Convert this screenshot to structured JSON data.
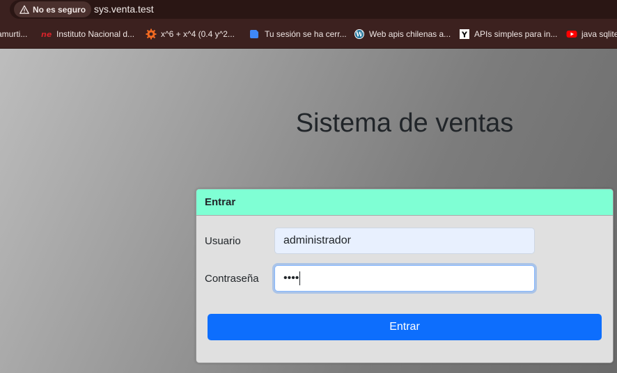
{
  "browser": {
    "security_label": "No es seguro",
    "url": "sys.venta.test"
  },
  "bookmarks": [
    {
      "label": "amurti...",
      "icon": "bookmark-icon"
    },
    {
      "label": "Instituto Nacional d...",
      "icon": "ine-logo-icon"
    },
    {
      "label": "x^6 + x^4 (0.4 y^2...",
      "icon": "wolfram-icon"
    },
    {
      "label": "Tu sesión se ha cerr...",
      "icon": "blue-logo-icon"
    },
    {
      "label": "Web apis chilenas a...",
      "icon": "wordpress-icon"
    },
    {
      "label": "APIs simples para in...",
      "icon": "ycombinator-icon"
    },
    {
      "label": "java sqlite",
      "icon": "youtube-icon"
    }
  ],
  "page": {
    "title": "Sistema de ventas"
  },
  "login": {
    "header": "Entrar",
    "username_label": "Usuario",
    "username_value": "administrador",
    "password_label": "Contraseña",
    "password_value": "••••",
    "submit_label": "Entrar"
  },
  "colors": {
    "card_header": "#7fffd4",
    "primary_button": "#0d6efd",
    "autofill": "#e8f0fe"
  }
}
